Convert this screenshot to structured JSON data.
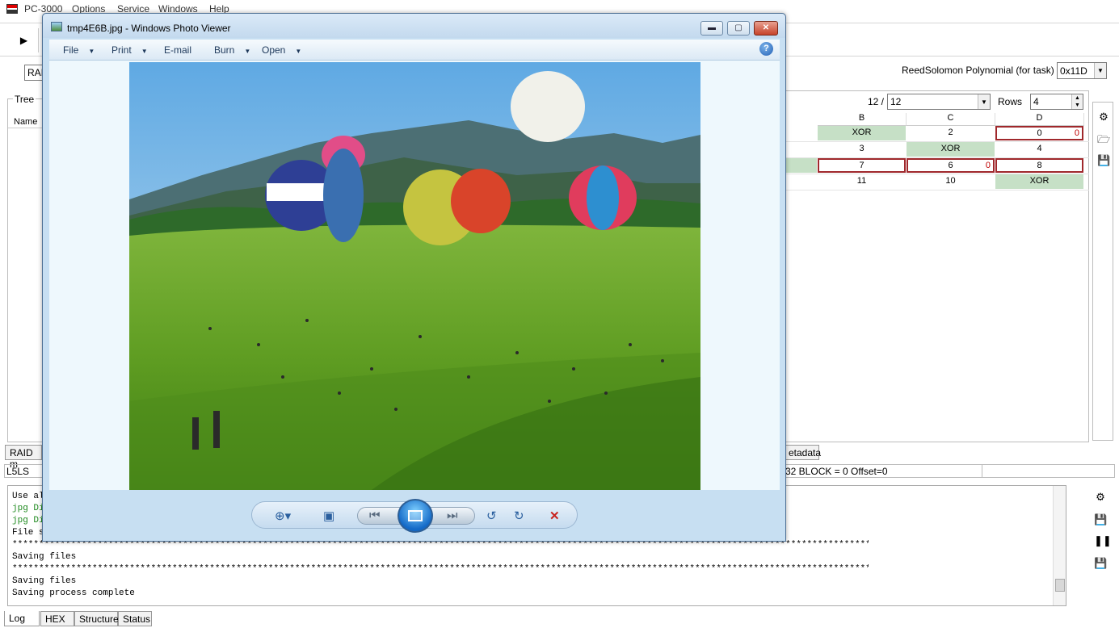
{
  "app": {
    "title": "PC-3000",
    "menu": [
      "Options",
      "Service",
      "Windows",
      "Help"
    ],
    "raid_combo": "RAI",
    "rs_label": "ReedSolomon Polynomial (for task)",
    "rs_value": "0x11D",
    "tree_legend": "Tree",
    "tree_name_col": "Name",
    "count_label": "12 /",
    "count_value": "12",
    "rows_label": "Rows",
    "rows_value": "4",
    "columns": [
      "B",
      "C",
      "D"
    ],
    "grid": {
      "r0": {
        "b": "XOR",
        "c": "2",
        "d": "0",
        "d_red": "0"
      },
      "r1": {
        "b": "3",
        "c": "XOR",
        "d": "4"
      },
      "r2": {
        "b": "7",
        "c": "6",
        "c_red": "0",
        "d": "8"
      },
      "r3": {
        "b": "11",
        "c": "10",
        "d": "XOR"
      }
    },
    "tabs_mid": {
      "raid": "RAID m",
      "metadata": "etadata"
    },
    "status": {
      "left": "L5LS",
      "right": "32 BLOCK = 0 Offset=0"
    },
    "log_lines": [
      "Use al",
      "jpg Di",
      "jpg Di",
      "File s",
      "***********************************************************************************************************************************************************************",
      "Saving files",
      "***********************************************************************************************************************************************************************",
      "Saving files",
      "Saving process complete"
    ],
    "bottom_tabs": [
      "Log",
      "HEX",
      "Structure",
      "Status"
    ]
  },
  "viewer": {
    "title": "tmp4E6B.jpg - Windows Photo Viewer",
    "menu": [
      "File",
      "Print",
      "E-mail",
      "Burn",
      "Open"
    ],
    "help": "?",
    "icons": {
      "zoom": "zoom-icon",
      "fit": "fit-window-icon",
      "prev": "previous-icon",
      "slideshow": "slideshow-icon",
      "next": "next-icon",
      "rotate_ccw": "rotate-counterclockwise-icon",
      "rotate_cw": "rotate-clockwise-icon",
      "delete": "delete-icon"
    }
  }
}
